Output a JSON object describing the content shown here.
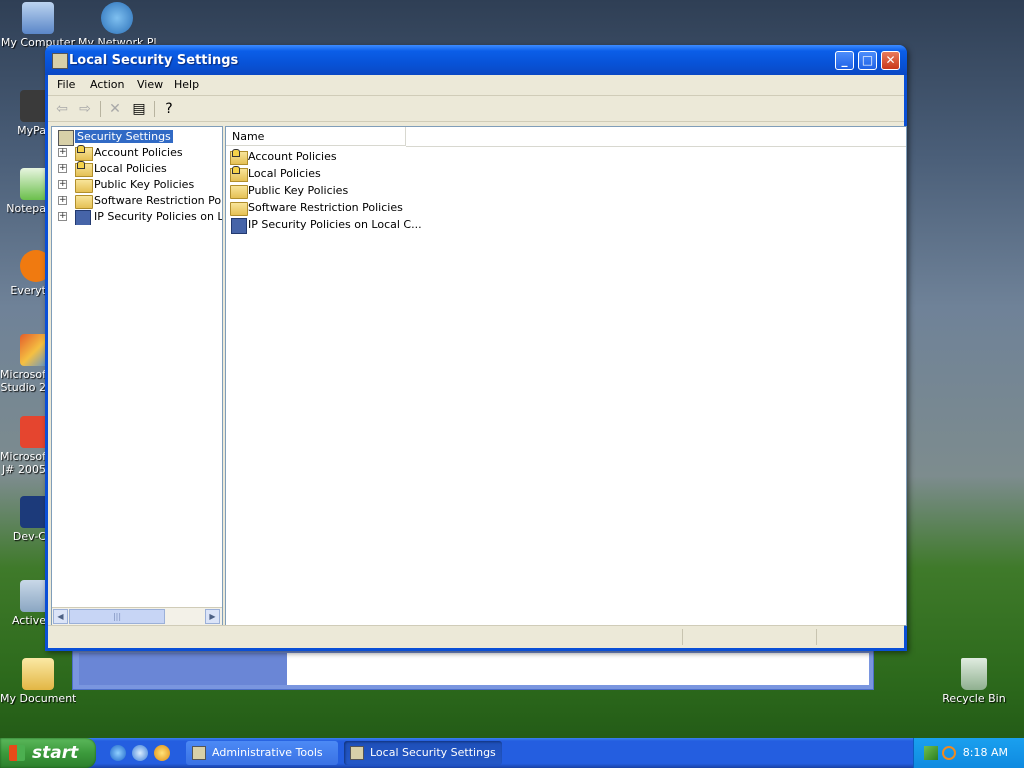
{
  "desktop": {
    "icons": [
      {
        "label": "My Computer",
        "icon": "my-computer-icon"
      },
      {
        "label": "My Network Places",
        "icon": "network-places-icon"
      },
      {
        "label": "MyPa",
        "icon": "mypa-icon"
      },
      {
        "label": "Notepa",
        "icon": "notepad-icon"
      },
      {
        "label": "Everyt",
        "icon": "everything-icon"
      },
      {
        "label": "Microsof Studio 2",
        "icon": "visual-studio-icon"
      },
      {
        "label": "Microsof J# 2005",
        "icon": "vjsharp-icon"
      },
      {
        "label": "Dev-C",
        "icon": "devcpp-icon"
      },
      {
        "label": "Active",
        "icon": "activestate-icon"
      },
      {
        "label": "My Documents",
        "icon": "my-documents-icon"
      },
      {
        "label": "Recycle Bin",
        "icon": "recycle-bin-icon"
      }
    ]
  },
  "window": {
    "title": "Local Security Settings",
    "menu": [
      "File",
      "Action",
      "View",
      "Help"
    ],
    "toolbar": [
      "back-arrow-icon",
      "forward-arrow-icon",
      "delete-icon",
      "export-list-icon",
      "help-icon"
    ],
    "tree": {
      "root": "Security Settings",
      "items": [
        {
          "label": "Account Policies",
          "icon": "lock-folder-icon"
        },
        {
          "label": "Local Policies",
          "icon": "lock-folder-icon"
        },
        {
          "label": "Public Key Policies",
          "icon": "folder-icon"
        },
        {
          "label": "Software Restriction Policie",
          "icon": "folder-icon"
        },
        {
          "label": "IP Security Policies on Loca",
          "icon": "ipsec-icon"
        }
      ]
    },
    "list": {
      "column": "Name",
      "rows": [
        {
          "label": "Account Policies",
          "icon": "lock-folder-icon"
        },
        {
          "label": "Local Policies",
          "icon": "lock-folder-icon"
        },
        {
          "label": "Public Key Policies",
          "icon": "folder-icon"
        },
        {
          "label": "Software Restriction Policies",
          "icon": "folder-icon"
        },
        {
          "label": "IP Security Policies on Local C...",
          "icon": "ipsec-icon"
        }
      ]
    },
    "scrollbar_grip": "|||"
  },
  "taskbar": {
    "start_label": "start",
    "tasks": [
      "Administrative Tools",
      "Local Security Settings"
    ],
    "clock": "8:18 AM"
  },
  "colors": {
    "title_blue": "#0853d8",
    "selection": "#316ac5",
    "taskbar_blue": "#245ee0",
    "start_green": "#3c9a3c"
  }
}
